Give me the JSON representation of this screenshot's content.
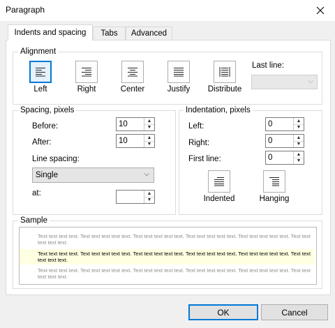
{
  "window": {
    "title": "Paragraph"
  },
  "tabs": [
    {
      "label": "Indents and spacing",
      "active": true
    },
    {
      "label": "Tabs",
      "active": false
    },
    {
      "label": "Advanced",
      "active": false
    }
  ],
  "alignment": {
    "group_label": "Alignment",
    "buttons": [
      {
        "label": "Left",
        "icon": "align-left-icon",
        "selected": true
      },
      {
        "label": "Right",
        "icon": "align-right-icon",
        "selected": false
      },
      {
        "label": "Center",
        "icon": "align-center-icon",
        "selected": false
      },
      {
        "label": "Justify",
        "icon": "align-justify-icon",
        "selected": false
      },
      {
        "label": "Distribute",
        "icon": "align-distribute-icon",
        "selected": false
      }
    ],
    "last_line_label": "Last line:",
    "last_line_value": ""
  },
  "spacing": {
    "group_label": "Spacing, pixels",
    "before_label": "Before:",
    "before_value": "10",
    "after_label": "After:",
    "after_value": "10",
    "line_spacing_label": "Line spacing:",
    "line_spacing_value": "Single",
    "at_label": "at:",
    "at_value": ""
  },
  "indentation": {
    "group_label": "Indentation, pixels",
    "left_label": "Left:",
    "left_value": "0",
    "right_label": "Right:",
    "right_value": "0",
    "first_line_label": "First line:",
    "first_line_value": "0",
    "indented_label": "Indented",
    "hanging_label": "Hanging"
  },
  "sample": {
    "group_label": "Sample",
    "before_text": "Text text text text. Text text text text text. Text text text text text. Text text text text text. Text text text text text. Text text text text text.",
    "current_text": "Text text text text. Text text text text text. Text text text text text. Text text text text text. Text text text text text. Text text text text text.",
    "after_text": "Text text text text. Text text text text text. Text text text text text. Text text text text text. Text text text text text. Text text text text text."
  },
  "buttons": {
    "ok": "OK",
    "cancel": "Cancel"
  },
  "colors": {
    "accent": "#0078d7",
    "sample_highlight": "#ffffe1"
  }
}
